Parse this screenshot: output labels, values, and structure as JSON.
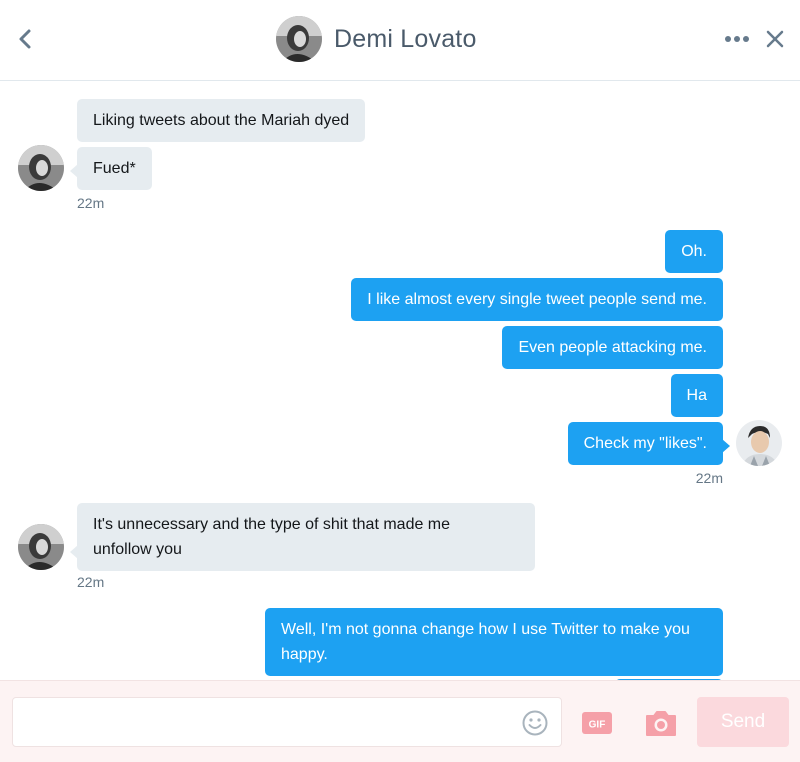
{
  "header": {
    "title": "Demi Lovato",
    "back_icon": "chevron-left-icon",
    "more_icon": "more-dots-icon",
    "close_icon": "close-icon"
  },
  "messages": [
    {
      "from": "them",
      "text": "Liking tweets about the Mariah dyed"
    },
    {
      "from": "them",
      "text": "Fued*"
    },
    {
      "from": "them_time",
      "text": "22m"
    },
    {
      "from": "me",
      "text": "Oh."
    },
    {
      "from": "me",
      "text": "I like almost every single tweet people send me."
    },
    {
      "from": "me",
      "text": "Even people attacking me."
    },
    {
      "from": "me",
      "text": "Ha"
    },
    {
      "from": "me",
      "text": "Check my \"likes\"."
    },
    {
      "from": "me_time",
      "text": "22m"
    },
    {
      "from": "them",
      "text": "It's unnecessary and the type of shit that made me unfollow you"
    },
    {
      "from": "them_time",
      "text": "22m"
    },
    {
      "from": "me",
      "text": "Well, I'm not gonna change how I use Twitter to make you happy."
    }
  ],
  "composer": {
    "input_value": "",
    "input_placeholder": "",
    "gif_label": "GIF",
    "send_label": "Send"
  },
  "colors": {
    "outgoing_bubble": "#1da1f2",
    "incoming_bubble": "#e6ecf0",
    "composer_background": "#fdf3f3",
    "send_button": "#fbd9dd",
    "composer_icons": "#f5a0a8"
  }
}
